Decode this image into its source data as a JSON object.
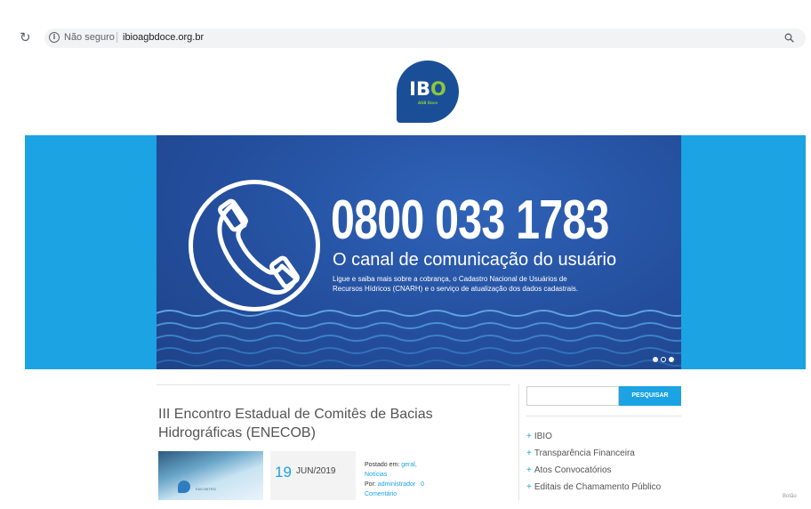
{
  "browser": {
    "reload_glyph": "↻",
    "info_glyph": "i",
    "security_label": "Não seguro",
    "url": "ibioagbdoce.org.br"
  },
  "logo": {
    "prefix": "IB",
    "i_letter": "I",
    "o_letter": "O",
    "sub": "AGB Doce"
  },
  "banner": {
    "phone": "0800 033 1783",
    "headline": "O canal de comunicação do usuário",
    "line1": "Ligue e saiba mais sobre a cobrança, o Cadastro Nacional de Usuários de",
    "line2": "Recursos Hídricos (CNARH) e o serviço de atualização dos dados cadastrais.",
    "slides_total": 3,
    "active_slide": 3
  },
  "post": {
    "title": "III Encontro Estadual de Comitês de Bacias Hidrográficas (ENECOB)",
    "day": "19",
    "month_year": "JUN/2019",
    "posted_in_label": "Postado em:",
    "category1": "geral,",
    "category2": "Notícias",
    "by_label": "Por:",
    "author": "administrador",
    "comments_count": "0",
    "comments_label": "Comentário",
    "thumb_caption": "ENCONTRO"
  },
  "sidebar": {
    "search_button": "PESQUISAR",
    "search_placeholder": "",
    "links": [
      {
        "label": "IBIO"
      },
      {
        "label": "Transparência Financeira"
      },
      {
        "label": "Atos Convocatórios"
      },
      {
        "label": "Editais de Chamamento Público"
      }
    ]
  },
  "corner_text": "Botão",
  "colors": {
    "accent": "#1ba3e3",
    "brand": "#1a4f97",
    "banner": "#244f9e"
  }
}
